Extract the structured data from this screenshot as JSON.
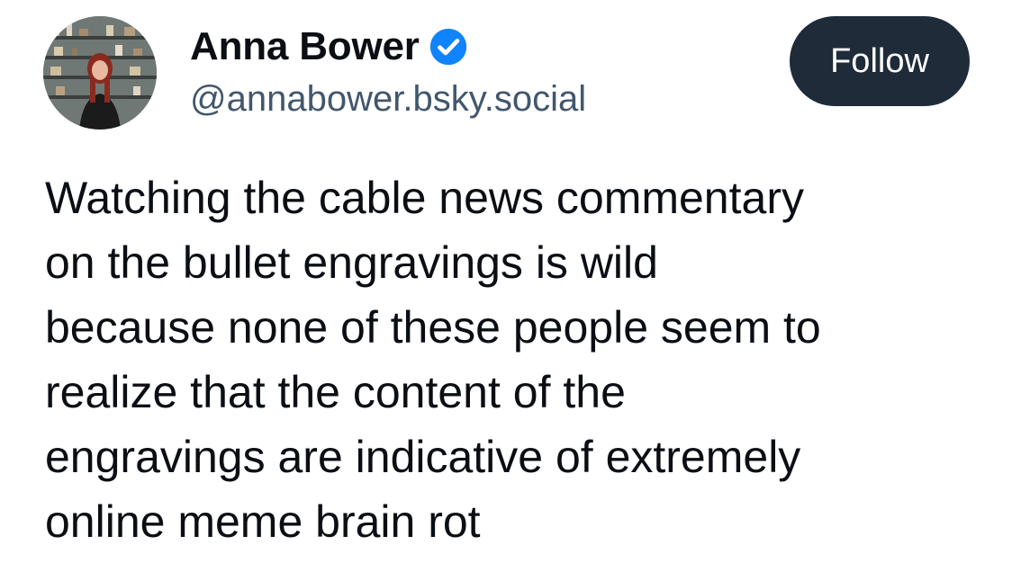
{
  "author": {
    "display_name": "Anna Bower",
    "handle": "@annabower.bsky.social",
    "verified_icon": "verified-check-icon",
    "avatar_icon": "profile-avatar"
  },
  "follow_button": {
    "label": "Follow"
  },
  "post": {
    "lines": [
      "Watching the cable news commentary",
      "on the bullet engravings is wild",
      "because none of these people seem to",
      "realize that the content of the",
      "engravings are indicative of extremely",
      "online meme brain rot"
    ]
  },
  "colors": {
    "accent": "#1083fe",
    "button_bg": "#1f2b38",
    "handle": "#42576c",
    "text": "#0b0f14"
  }
}
